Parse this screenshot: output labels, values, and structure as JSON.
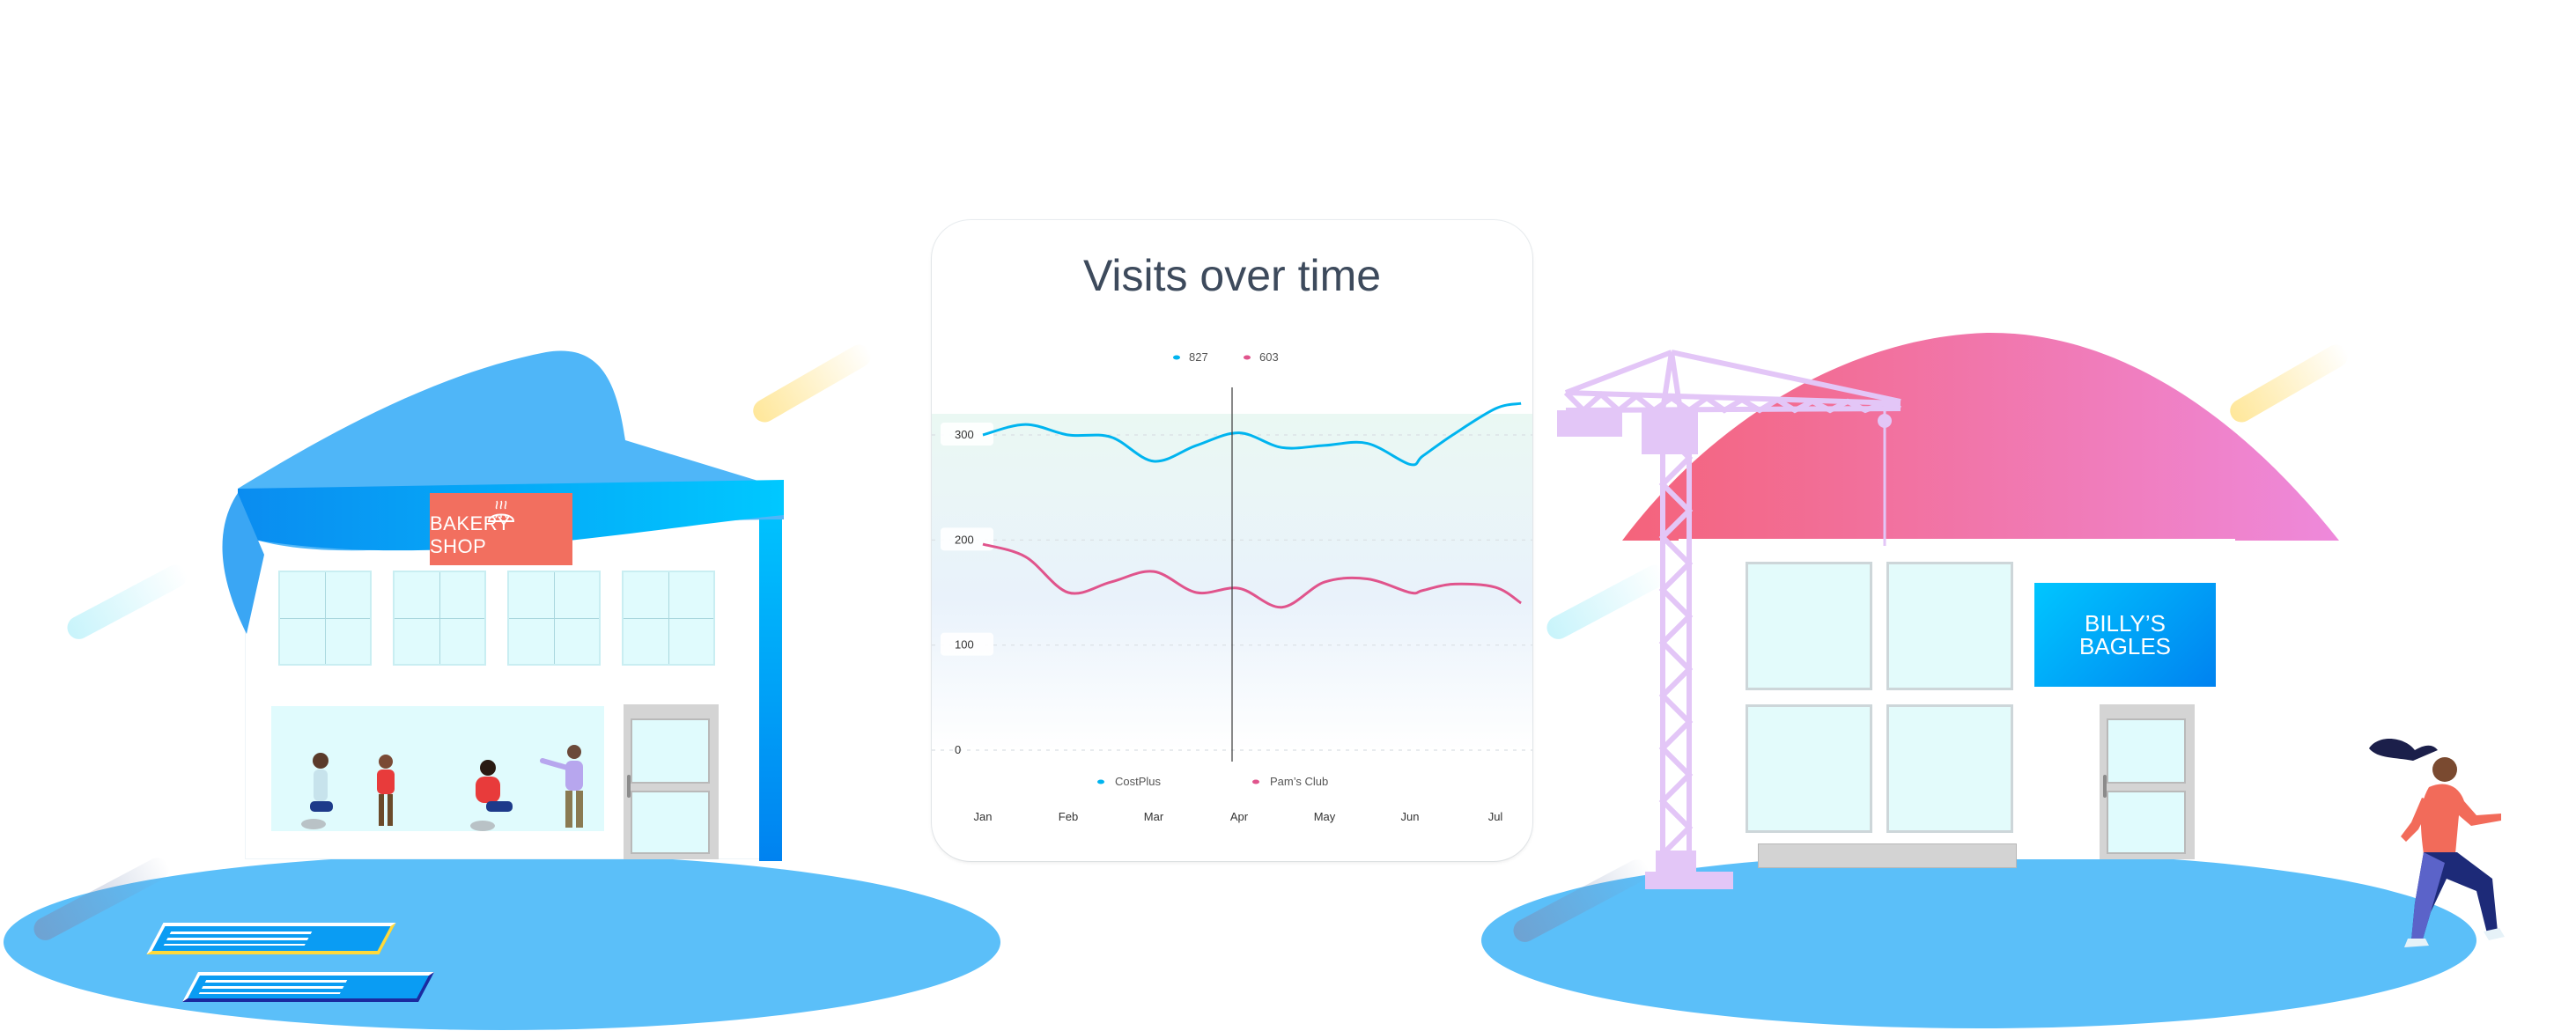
{
  "colors": {
    "ground": "#5bbff9",
    "series_costplus": "#00b4ef",
    "series_pams_club": "#e0548c",
    "bakery_sign": "#f26f5f",
    "crane": "#e3c6f7",
    "roof_pink_start": "#f4637b",
    "roof_pink_end": "#ee89db"
  },
  "bakery": {
    "sign_label": "BAKERY SHOP",
    "sign_icon": "bread-icon"
  },
  "billys": {
    "sign_line1": "BILLY’S",
    "sign_line2": "BAGLES"
  },
  "chart_data": {
    "type": "line",
    "title": "Visits over time",
    "xlabel": "",
    "ylabel": "",
    "categories": [
      "Jan",
      "Feb",
      "Mar",
      "Apr",
      "May",
      "Jun",
      "Jul"
    ],
    "x": [
      0,
      0.5,
      1,
      1.5,
      2,
      2.5,
      3,
      3.5,
      4,
      4.5,
      5,
      5.15,
      5.5,
      6,
      6.3
    ],
    "ylim": [
      0,
      300
    ],
    "yticks": [
      0,
      100,
      200,
      300
    ],
    "grid": true,
    "legend": "bottom",
    "hover": {
      "category": "Apr",
      "values": [
        "827",
        "603"
      ]
    },
    "series": [
      {
        "name": "CostPlus",
        "color": "#00b4ef",
        "values": [
          300,
          310,
          300,
          298,
          275,
          290,
          302,
          288,
          290,
          292,
          272,
          280,
          300,
          325,
          330
        ]
      },
      {
        "name": "Pam’s Club",
        "color": "#e0548c",
        "values": [
          196,
          184,
          150,
          160,
          170,
          150,
          154,
          136,
          160,
          163,
          150,
          152,
          158,
          155,
          140
        ]
      }
    ]
  }
}
